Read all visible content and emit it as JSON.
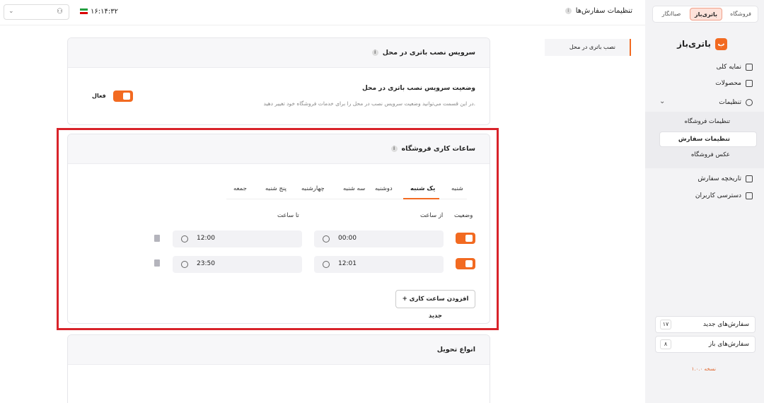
{
  "sidebar": {
    "switch": {
      "left": "صباانگار",
      "middle": "باتری‌باز",
      "right": "فروشگاه"
    },
    "brand": "باتری‌باز",
    "brand_icon": "logo-icon",
    "items": [
      {
        "label": "نمایه کلی",
        "icon": "dashboard-icon"
      },
      {
        "label": "محصولات",
        "icon": "box-icon"
      },
      {
        "label": "تنظیمات",
        "icon": "gear-icon"
      },
      {
        "label": "تاریخچه سفارش",
        "icon": "history-icon"
      },
      {
        "label": "دسترسی کاربران",
        "icon": "users-icon"
      }
    ],
    "sub_items": [
      "تنظیمات فروشگاه",
      "تنظیمات سفارش",
      "عکس فروشگاه"
    ],
    "counts": [
      {
        "label": "سفارش‌های جدید",
        "value": "۱۷"
      },
      {
        "label": "سفارش‌های باز",
        "value": "۸"
      }
    ],
    "version": "نسخه ۱.۰.۰"
  },
  "topbar": {
    "title": "تنظیمات سفارش‌ها",
    "clock": "۱۶:۱۴:۳۲"
  },
  "secondary_nav": {
    "item": "نصب باتری در محل"
  },
  "install_card": {
    "title": "سرویس نصب باتری در محل",
    "label": "وضعیت سرویس نصب باتری در محل",
    "desc": "در این قسمت می‌توانید وضعیت سرویس نصب در محل را برای خدمات فروشگاه خود تغییر دهید.",
    "status": "فعال"
  },
  "hours_card": {
    "title": "ساعات کاری فروشگاه",
    "tabs": [
      "شنبه",
      "یک شنبه",
      "دوشنبه",
      "سه شنبه",
      "چهارشنبه",
      "پنج شنبه",
      "جمعه"
    ],
    "headers": {
      "status": "وضعیت",
      "from": "از ساعت",
      "to": "تا ساعت"
    },
    "rows": [
      {
        "from": "00:00",
        "to": "12:00"
      },
      {
        "from": "12:01",
        "to": "23:50"
      }
    ],
    "add_button": "افزودن ساعت کاری جدید"
  },
  "delivery_card": {
    "title": "انواع تحویل"
  },
  "colors": {
    "accent": "#f26a21",
    "highlight": "#d8232a"
  }
}
